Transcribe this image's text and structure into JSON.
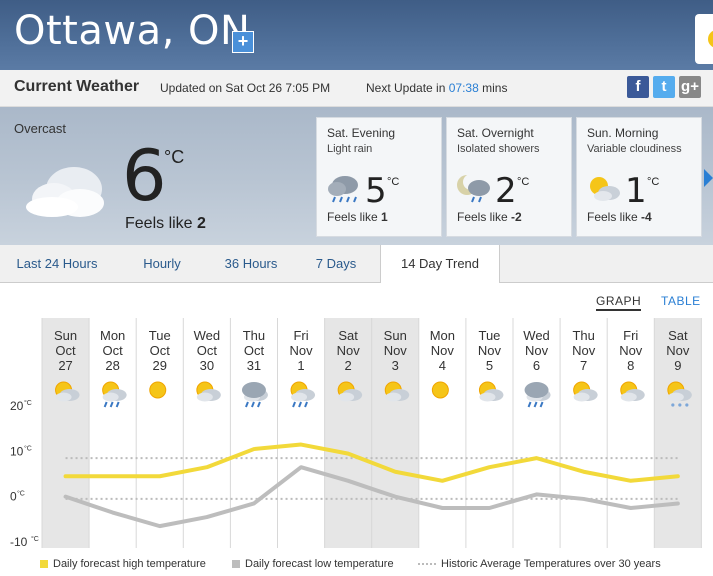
{
  "location": {
    "city": "Ottawa, ON",
    "add_label": "+"
  },
  "current": {
    "title": "Current Weather",
    "updated": "Updated on Sat Oct 26 7:05 PM",
    "next_update_prefix": "Next Update in",
    "next_update_time": "07:38",
    "next_update_suffix": "mins",
    "condition": "Overcast",
    "temp": "6",
    "unit": "°C",
    "feels_label": "Feels like",
    "feels_value": "2"
  },
  "social": {
    "facebook": "f",
    "twitter": "t",
    "googleplus": "g+"
  },
  "short_forecast": [
    {
      "period": "Sat. Evening",
      "condition": "Light rain",
      "temp": "5",
      "unit": "°C",
      "feels_label": "Feels like",
      "feels_value": "1",
      "icon": "rain-cloud-icon"
    },
    {
      "period": "Sat. Overnight",
      "condition": "Isolated showers",
      "temp": "2",
      "unit": "°C",
      "feels_label": "Feels like",
      "feels_value": "-2",
      "icon": "moon-showers-icon"
    },
    {
      "period": "Sun. Morning",
      "condition": "Variable cloudiness",
      "temp": "1",
      "unit": "°C",
      "feels_label": "Feels like",
      "feels_value": "-4",
      "icon": "sun-cloud-icon"
    }
  ],
  "tabs": [
    {
      "label": "Last 24 Hours",
      "active": false
    },
    {
      "label": "Hourly",
      "active": false
    },
    {
      "label": "36 Hours",
      "active": false
    },
    {
      "label": "7 Days",
      "active": false
    },
    {
      "label": "14 Day Trend",
      "active": true
    }
  ],
  "view_toggle": {
    "graph": "GRAPH",
    "table": "TABLE"
  },
  "chart_data": {
    "type": "line",
    "x_days": [
      {
        "dow": "Sun",
        "mon": "Oct",
        "day": "27",
        "icon": "sun-cloud-icon"
      },
      {
        "dow": "Mon",
        "mon": "Oct",
        "day": "28",
        "icon": "sun-cloud-rain-icon"
      },
      {
        "dow": "Tue",
        "mon": "Oct",
        "day": "29",
        "icon": "sun-icon"
      },
      {
        "dow": "Wed",
        "mon": "Oct",
        "day": "30",
        "icon": "sun-cloud-icon"
      },
      {
        "dow": "Thu",
        "mon": "Oct",
        "day": "31",
        "icon": "rain-cloud-icon"
      },
      {
        "dow": "Fri",
        "mon": "Nov",
        "day": "1",
        "icon": "sun-cloud-rain-icon"
      },
      {
        "dow": "Sat",
        "mon": "Nov",
        "day": "2",
        "icon": "sun-cloud-icon"
      },
      {
        "dow": "Sun",
        "mon": "Nov",
        "day": "3",
        "icon": "sun-cloud-icon"
      },
      {
        "dow": "Mon",
        "mon": "Nov",
        "day": "4",
        "icon": "sun-icon"
      },
      {
        "dow": "Tue",
        "mon": "Nov",
        "day": "5",
        "icon": "sun-cloud-icon"
      },
      {
        "dow": "Wed",
        "mon": "Nov",
        "day": "6",
        "icon": "rain-cloud-icon"
      },
      {
        "dow": "Thu",
        "mon": "Nov",
        "day": "7",
        "icon": "sun-cloud-icon"
      },
      {
        "dow": "Fri",
        "mon": "Nov",
        "day": "8",
        "icon": "sun-cloud-icon"
      },
      {
        "dow": "Sat",
        "mon": "Nov",
        "day": "9",
        "icon": "sun-cloud-snow-icon"
      }
    ],
    "shaded_days": [
      0,
      6,
      7,
      13
    ],
    "y_ticks": [
      20,
      10,
      0,
      -10
    ],
    "y_unit": "°C",
    "ylim": [
      -10,
      20
    ],
    "series": [
      {
        "name": "Daily forecast high temperature",
        "color": "#f2d93a",
        "values": [
          4.5,
          4.5,
          4.5,
          6.5,
          10.5,
          11.5,
          9.5,
          5.5,
          3.5,
          6.5,
          8.5,
          5.5,
          3.5,
          4.5
        ]
      },
      {
        "name": "Daily forecast low temperature",
        "color": "#bdbdbd",
        "values": [
          0,
          -3.5,
          -6.5,
          -4.5,
          -1.5,
          6.5,
          3.5,
          0,
          -2.5,
          -2.5,
          0.5,
          -0.5,
          -2.5,
          -1.5
        ]
      }
    ],
    "historic_average": {
      "name": "Historic Average Temperatures over 30 years",
      "high": 8.5,
      "low": -0.5,
      "color": "#bbbbbb"
    },
    "grid": true
  }
}
